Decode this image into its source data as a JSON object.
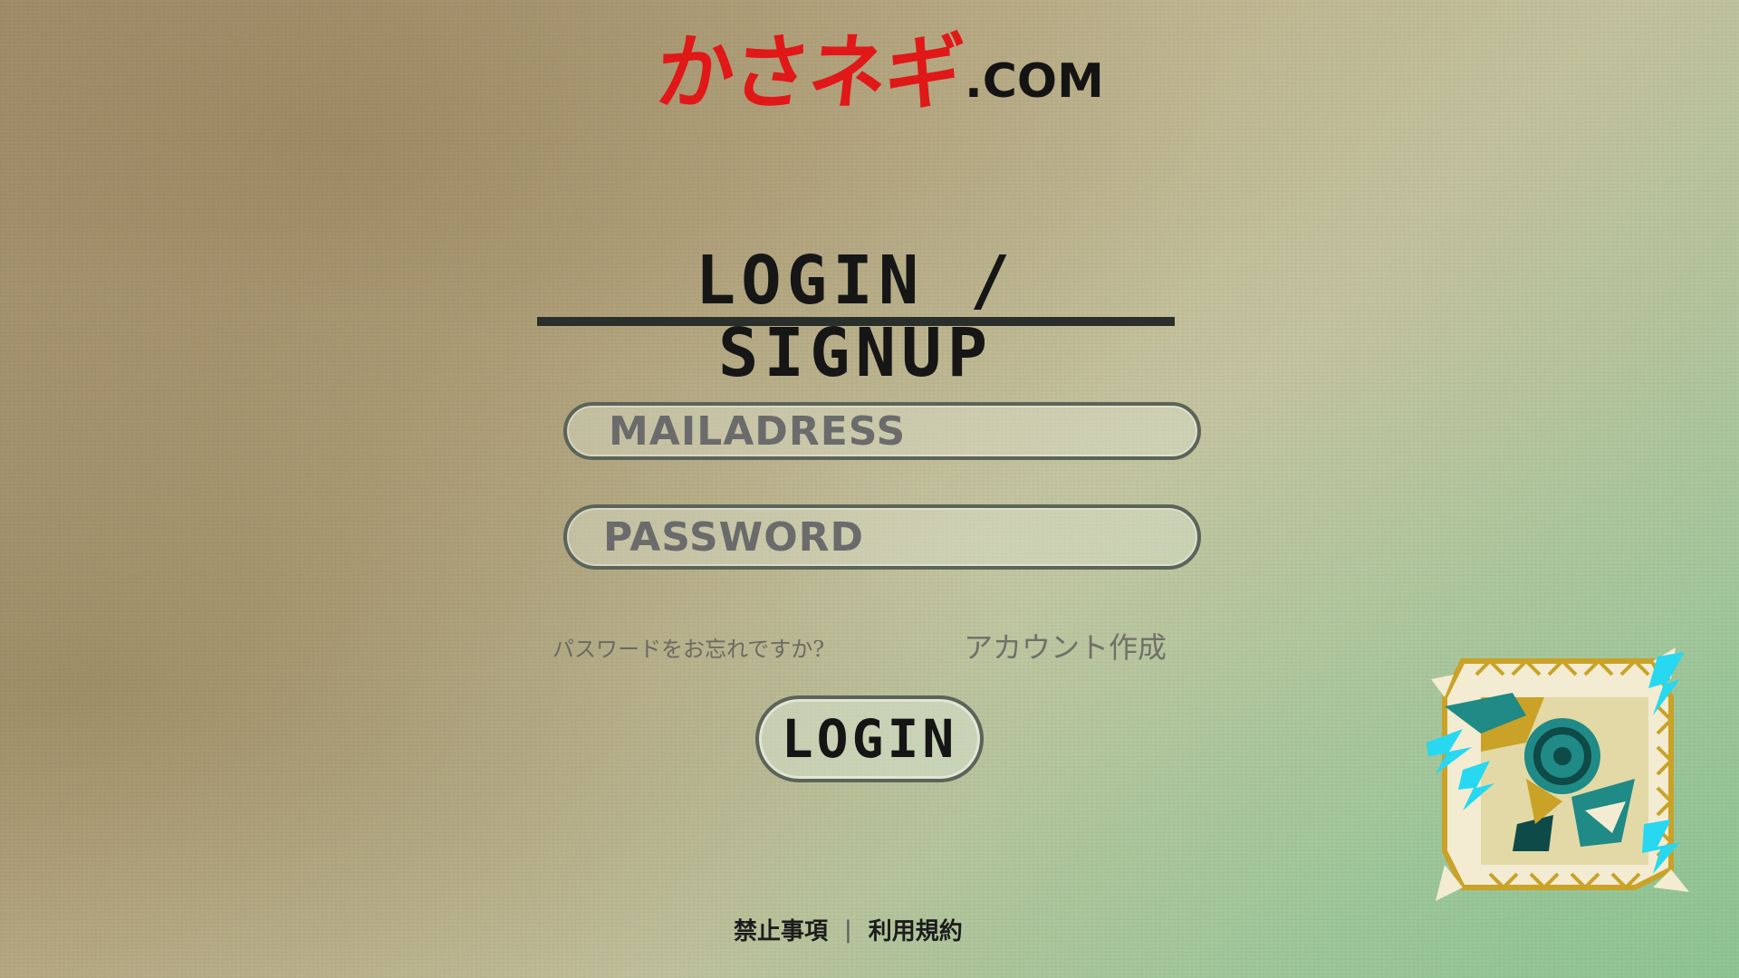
{
  "logo": {
    "jp": "かさネギ",
    "suffix": ".COM"
  },
  "title": "LOGIN / SIGNUP",
  "form": {
    "email_placeholder": "MAILADRESS",
    "password_placeholder": "PASSWORD",
    "forgot_password": "パスワードをお忘れですか?",
    "create_account": "アカウント作成",
    "login_button": "LOGIN"
  },
  "footer": {
    "prohibited": "禁止事項",
    "separator": "|",
    "terms": "利用規約"
  },
  "colors": {
    "logo_red": "#e01818",
    "text_dark": "#161616",
    "field_border": "#5b6458",
    "emblem_gold": "#c9a227",
    "emblem_teal": "#1f8a86",
    "emblem_cyan": "#27d8f0",
    "emblem_cream": "#f3ecd2"
  },
  "icons": {
    "emblem": "monster-crest-emblem"
  }
}
